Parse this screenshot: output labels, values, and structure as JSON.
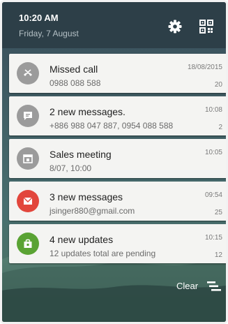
{
  "status_bar": {
    "time": "10:20 AM",
    "date": "Friday, 7 August",
    "settings_icon": "gear-icon",
    "quick_settings_icon": "quick-settings-icon"
  },
  "notifications": [
    {
      "title": "Missed call",
      "subtitle": "0988 088 588",
      "timestamp": "18/08/2015",
      "count": "20",
      "icon": "missed-call-icon",
      "color": "#9b9b9b"
    },
    {
      "title": "2 new messages.",
      "subtitle": "+886 988 047 887, 0954 088 588",
      "timestamp": "10:08",
      "count": "2",
      "icon": "message-icon",
      "color": "#9b9b9b"
    },
    {
      "title": "Sales meeting",
      "subtitle": "8/07, 10:00",
      "timestamp": "10:05",
      "count": "",
      "icon": "calendar-icon",
      "color": "#9b9b9b"
    },
    {
      "title": "3 new messages",
      "subtitle": "jsinger880@gmail.com",
      "timestamp": "09:54",
      "count": "25",
      "icon": "mail-icon",
      "color": "#e2463c"
    },
    {
      "title": "4 new updates",
      "subtitle": "12 updates total are pending",
      "timestamp": "10:15",
      "count": "12",
      "icon": "store-icon",
      "color": "#5aa334"
    }
  ],
  "clear": {
    "label": "Clear",
    "icon": "clear-all-icon"
  }
}
